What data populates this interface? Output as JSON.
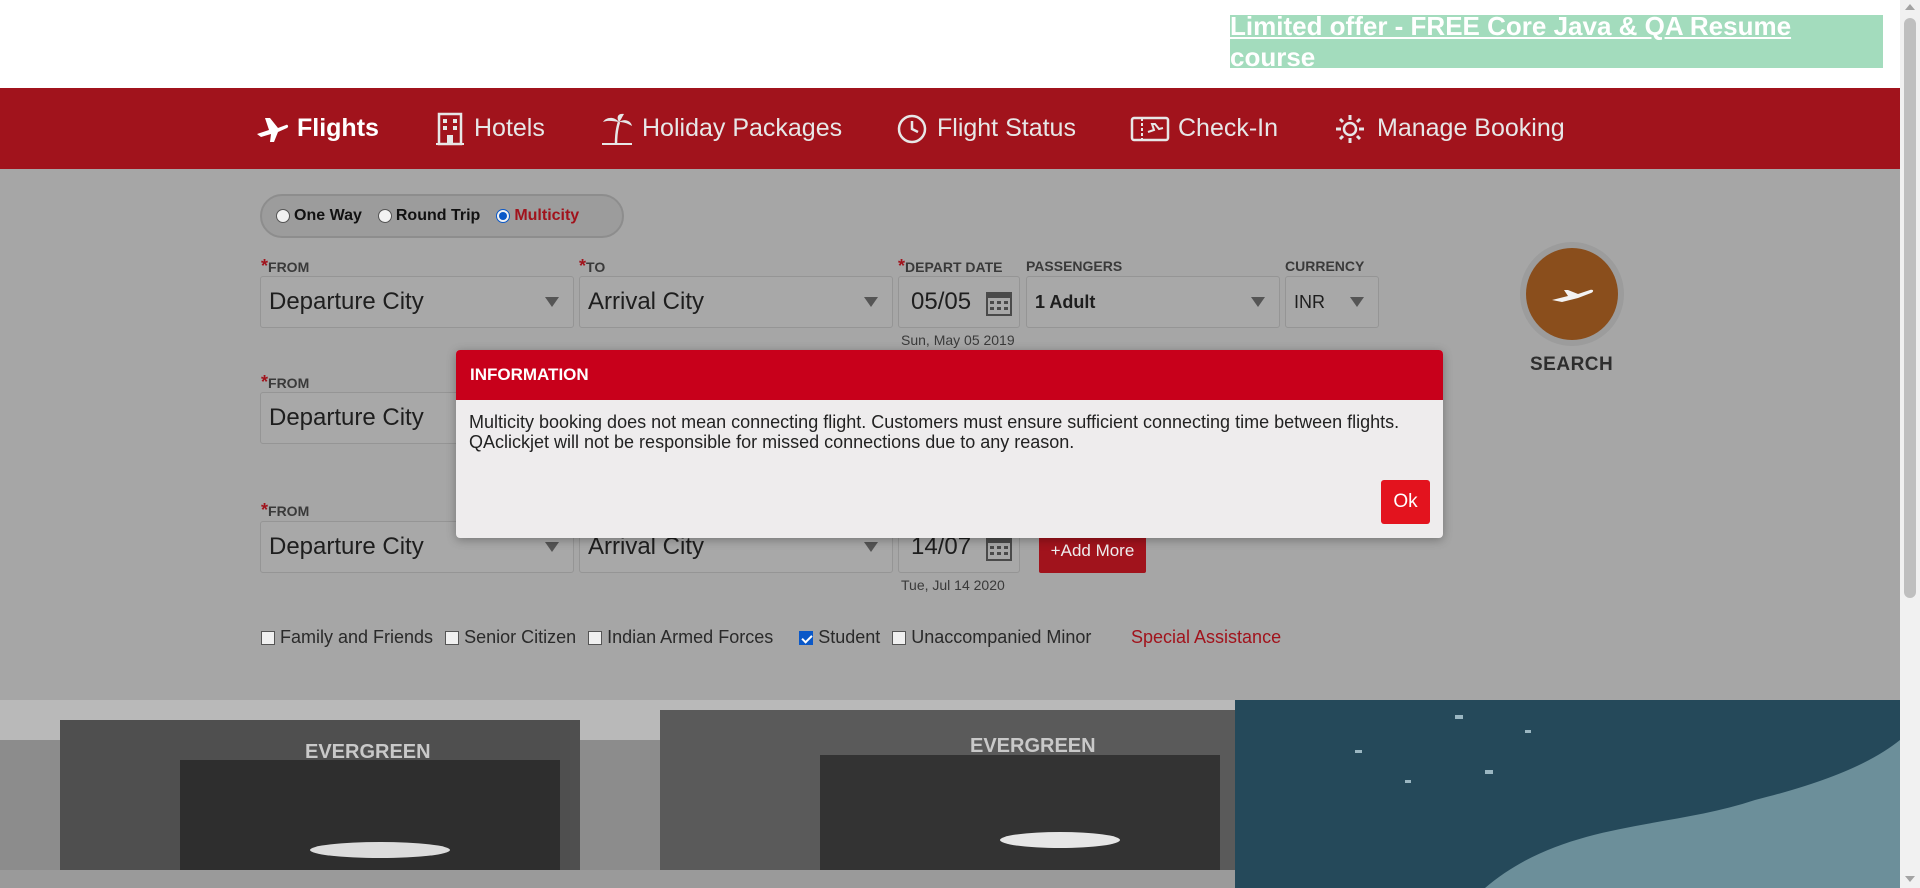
{
  "offer_banner": {
    "text": "Limited offer - FREE Core Java & QA Resume course"
  },
  "nav": {
    "items": [
      {
        "label": "Flights",
        "icon": "plane-icon",
        "active": true
      },
      {
        "label": "Hotels",
        "icon": "hotel-icon"
      },
      {
        "label": "Holiday Packages",
        "icon": "palm-tree-icon"
      },
      {
        "label": "Flight Status",
        "icon": "clock-icon"
      },
      {
        "label": "Check-In",
        "icon": "ticket-icon"
      },
      {
        "label": "Manage Booking",
        "icon": "gear-icon"
      }
    ]
  },
  "trip_type": {
    "options": [
      "One Way",
      "Round Trip",
      "Multicity"
    ],
    "selected": "Multicity"
  },
  "labels": {
    "from": "FROM",
    "to": "TO",
    "depart_date": "DEPART DATE",
    "passengers": "PASSENGERS",
    "currency": "CURRENCY",
    "required_mark": "*"
  },
  "rows": [
    {
      "from": "Departure City",
      "to": "Arrival City",
      "date": "05/05",
      "date_full": "Sun, May 05 2019"
    },
    {
      "from": "Departure City"
    },
    {
      "from": "Departure City",
      "to": "Arrival City",
      "date": "14/07",
      "date_full": "Tue, Jul 14 2020"
    }
  ],
  "passengers_value": "1 Adult",
  "currency_value": "INR",
  "add_more_label": "+Add More",
  "search_label": "SEARCH",
  "discounts": [
    {
      "label": "Family and Friends",
      "checked": false
    },
    {
      "label": "Senior Citizen",
      "checked": false
    },
    {
      "label": "Indian Armed Forces",
      "checked": false
    },
    {
      "label": "Student",
      "checked": true
    },
    {
      "label": "Unaccompanied Minor",
      "checked": false
    }
  ],
  "special_assistance": "Special Assistance",
  "modal": {
    "title": "INFORMATION",
    "message": "Multicity booking does not mean connecting flight. Customers must ensure sufficient connecting time between flights. QAclickjet will not be responsible for missed connections due to any reason.",
    "ok_label": "Ok"
  },
  "colors": {
    "brand": "#a1131c",
    "modal_header": "#c8001b",
    "ok_button": "#e3131e",
    "offer_bg": "#a3dcbd"
  },
  "photo_texts": [
    "EVERGREEN",
    "EVERGREEN"
  ]
}
